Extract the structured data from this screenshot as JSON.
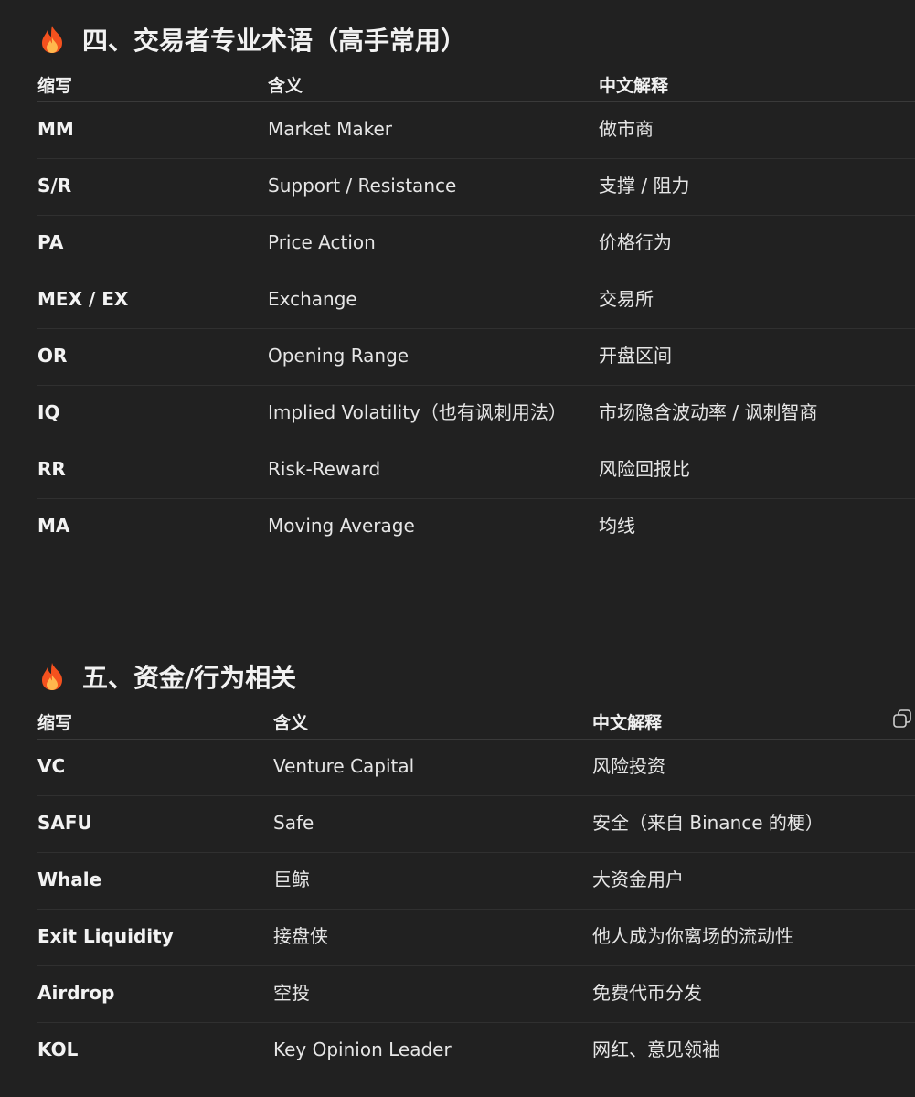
{
  "section4": {
    "title": "四、交易者专业术语（高手常用）",
    "headers": [
      "缩写",
      "含义",
      "中文解释"
    ],
    "rows": [
      {
        "abbr": "MM",
        "meaning": "Market Maker",
        "chinese": "做市商"
      },
      {
        "abbr": "S/R",
        "meaning": "Support / Resistance",
        "chinese": "支撑 / 阻力"
      },
      {
        "abbr": "PA",
        "meaning": "Price Action",
        "chinese": "价格行为"
      },
      {
        "abbr": "MEX / EX",
        "meaning": "Exchange",
        "chinese": "交易所"
      },
      {
        "abbr": "OR",
        "meaning": "Opening Range",
        "chinese": "开盘区间"
      },
      {
        "abbr": "IQ",
        "meaning": "Implied Volatility（也有讽刺用法）",
        "chinese": "市场隐含波动率 / 讽刺智商"
      },
      {
        "abbr": "RR",
        "meaning": "Risk-Reward",
        "chinese": "风险回报比"
      },
      {
        "abbr": "MA",
        "meaning": "Moving Average",
        "chinese": "均线"
      }
    ]
  },
  "section5": {
    "title": "五、资金/行为相关",
    "headers": [
      "缩写",
      "含义",
      "中文解释"
    ],
    "rows": [
      {
        "abbr": "VC",
        "meaning": "Venture Capital",
        "chinese": "风险投资"
      },
      {
        "abbr": "SAFU",
        "meaning": "Safe",
        "chinese": "安全（来自 Binance 的梗）"
      },
      {
        "abbr": "Whale",
        "meaning": "巨鲸",
        "chinese": "大资金用户"
      },
      {
        "abbr": "Exit Liquidity",
        "meaning": "接盘侠",
        "chinese": "他人成为你离场的流动性"
      },
      {
        "abbr": "Airdrop",
        "meaning": "空投",
        "chinese": "免费代币分发"
      },
      {
        "abbr": "KOL",
        "meaning": "Key Opinion Leader",
        "chinese": "网红、意见领袖"
      }
    ]
  },
  "icons": {
    "section_icon": "fire-icon",
    "copy": "copy-icon"
  },
  "colors": {
    "background": "#212121",
    "fire_outer": "#f4511e",
    "fire_inner": "#ffb74d"
  }
}
